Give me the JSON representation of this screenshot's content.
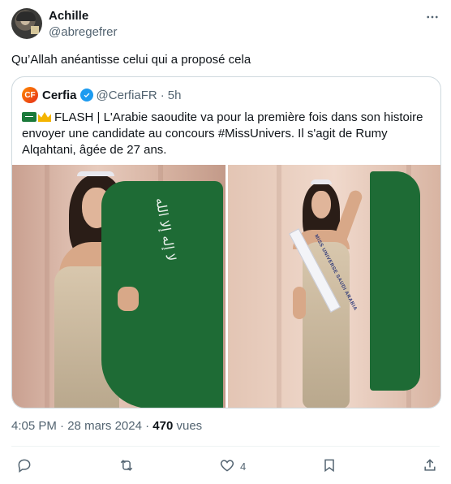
{
  "author": {
    "display_name": "Achille",
    "handle": "@abregefrer"
  },
  "more_icon": "more-horizontal-icon",
  "tweet": {
    "text": "Qu’Allah anéantisse celui qui a proposé cela"
  },
  "quoted": {
    "display_name": "Cerfia",
    "logo_text": "CF",
    "handle": "@CerfiaFR",
    "separator": "·",
    "age": "5h",
    "verified": true,
    "body": "FLASH | L'Arabie saoudite va pour la première fois dans son histoire envoyer une candidate au concours #MissUnivers. Il s'agit de Rumy Alqahtani, âgée de 27 ans.",
    "images": [
      {
        "description_icon": "photo-left"
      },
      {
        "description_icon": "photo-right"
      }
    ],
    "flag_script": "لا إله إلا الله",
    "sash_text": "MISS UNIVERSE SAUDI ARABIA"
  },
  "meta": {
    "time": "4:05 PM",
    "separator": "·",
    "date": "28 mars 2024",
    "views_count": "470",
    "views_label": "vues"
  },
  "actions": {
    "reply_count": "",
    "retweet_count": "",
    "like_count": "4",
    "bookmark_count": ""
  },
  "colors": {
    "text": "#0f1419",
    "secondary": "#536471",
    "verified": "#1d9bf0",
    "border": "#cfd9de",
    "flag_green": "#1e6b35"
  }
}
